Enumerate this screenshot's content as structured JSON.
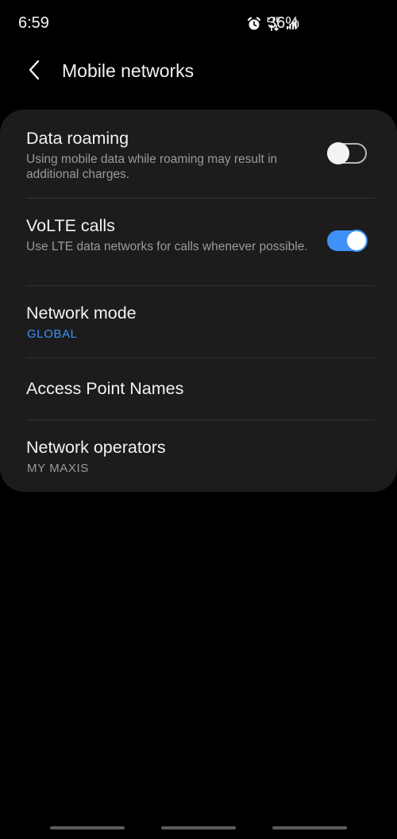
{
  "status_bar": {
    "time": "6:59",
    "network": "LTE",
    "battery": "36%",
    "icons": [
      "alarm-icon",
      "lte-data-icon",
      "signal-icon"
    ]
  },
  "header": {
    "back_icon": "chevron-left-icon",
    "title": "Mobile networks"
  },
  "settings": {
    "data_roaming": {
      "title": "Data roaming",
      "description": "Using mobile data while roaming may result in additional charges.",
      "enabled": false
    },
    "volte": {
      "title": "VoLTE calls",
      "description": "Use LTE data networks for calls whenever possible.",
      "enabled": true
    },
    "network_mode": {
      "title": "Network mode",
      "value": "GLOBAL"
    },
    "apn": {
      "title": "Access Point Names"
    },
    "network_operators": {
      "title": "Network operators",
      "value": "MY MAXIS"
    }
  },
  "colors": {
    "accent": "#3e91f7",
    "card_background": "#1c1c1c",
    "secondary_text": "#9a9a9a"
  }
}
